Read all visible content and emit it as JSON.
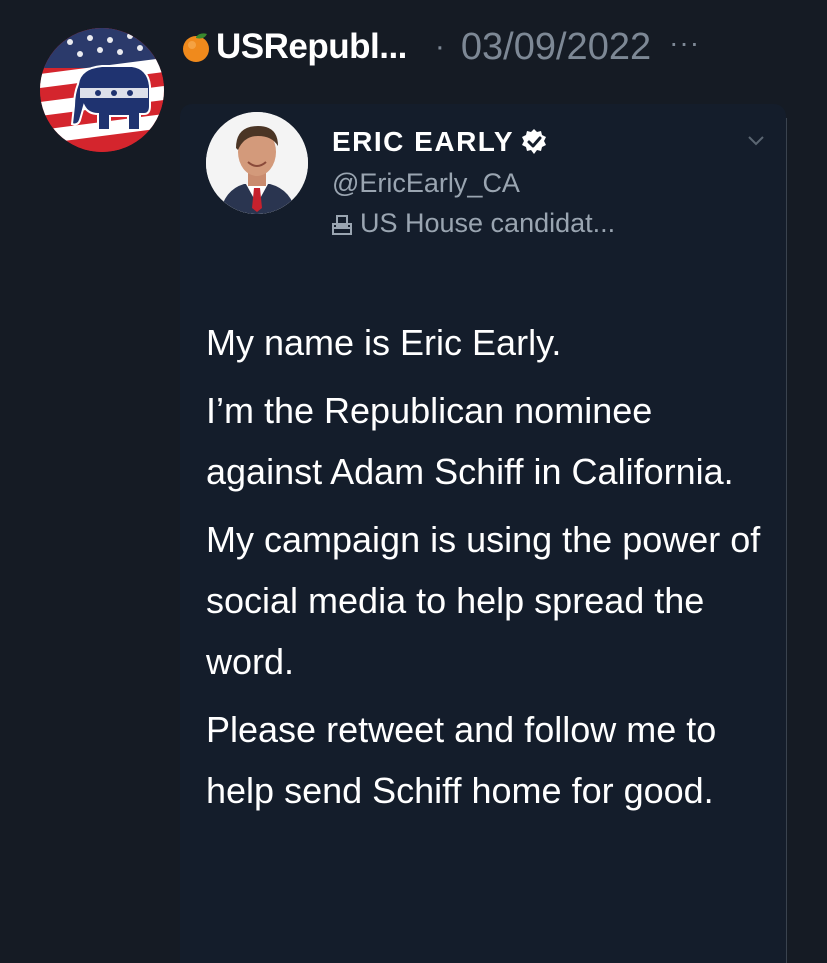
{
  "post": {
    "display_name": "USRepubl...",
    "separator": "·",
    "date": "03/09/2022",
    "more_label": "···"
  },
  "quoted": {
    "name": "ERIC EARLY",
    "handle": "@EricEarly_CA",
    "bio": "US House candidat...",
    "paragraphs": [
      "My name is Eric Early.",
      "I’m the Republican nominee against Adam Schiff in California.",
      "My campaign is using the power of social media to help spread the word.",
      "Please retweet and follow me to help send Schiff home for good."
    ]
  },
  "colors": {
    "background": "#151b24",
    "card": "#141d2b",
    "muted_text": "#7d8895",
    "verified": "#ffffff"
  },
  "icons": {
    "outer_avatar": "republican-elephant-flag-avatar",
    "emoji": "tangerine-icon",
    "verified": "verified-badge-icon",
    "bio": "ballot-box-icon",
    "chevron": "chevron-down-icon"
  }
}
